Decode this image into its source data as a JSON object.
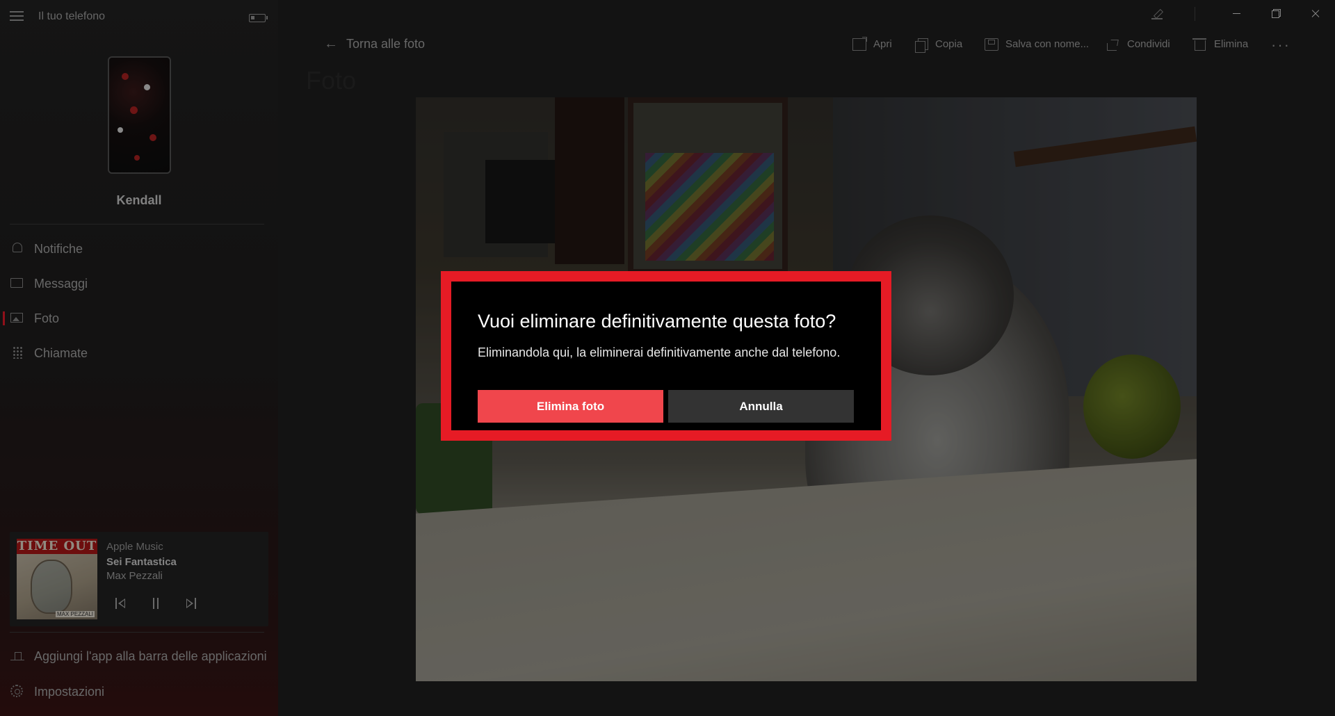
{
  "app": {
    "title": "Il tuo telefono"
  },
  "device": {
    "name": "Kendall"
  },
  "nav": {
    "items": [
      {
        "label": "Notifiche",
        "icon": "bell-icon"
      },
      {
        "label": "Messaggi",
        "icon": "message-icon"
      },
      {
        "label": "Foto",
        "icon": "photo-icon",
        "active": true
      },
      {
        "label": "Chiamate",
        "icon": "dialpad-icon"
      }
    ],
    "pin_label": "Aggiungi l'app alla barra delle applicazioni",
    "settings_label": "Impostazioni"
  },
  "music": {
    "source": "Apple Music",
    "title": "Sei Fantastica",
    "artist": "Max Pezzali",
    "album_text": "TIME OUT",
    "album_tag": "MAX PEZZALI"
  },
  "main": {
    "back_label": "Torna alle foto",
    "page_title": "Foto",
    "toolbar": {
      "open": "Apri",
      "copy": "Copia",
      "save_as": "Salva con nome...",
      "share": "Condividi",
      "delete": "Elimina",
      "more": "···"
    }
  },
  "dialog": {
    "title": "Vuoi eliminare definitivamente questa foto?",
    "body": "Eliminandola qui, la eliminerai definitivamente anche dal telefono.",
    "confirm_label": "Elimina foto",
    "cancel_label": "Annulla"
  },
  "colors": {
    "accent": "#e61b25",
    "delete_button": "#f0464c",
    "cancel_button": "#333333"
  }
}
